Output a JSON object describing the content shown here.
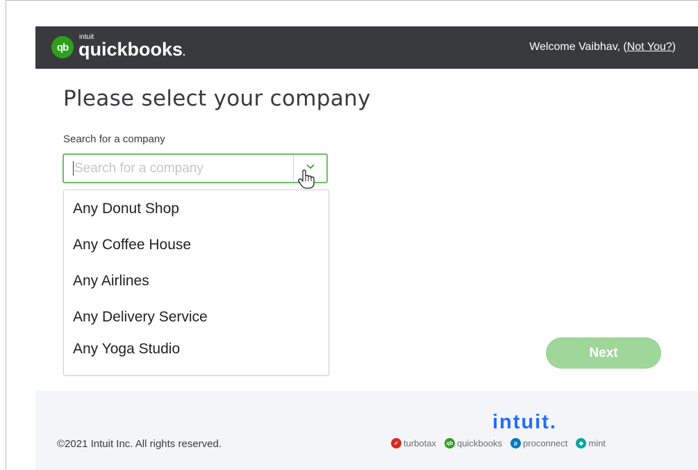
{
  "header": {
    "logo_badge": "qb",
    "brand_small": "intuit",
    "brand_name": "quickbooks",
    "brand_dot": ".",
    "welcome_text": "Welcome Vaibhav, (",
    "not_you_link": "Not You?",
    "welcome_close": ")"
  },
  "main": {
    "title": "Please select your company",
    "search_label": "Search for a company",
    "search_placeholder": "Search for a company",
    "search_value": "",
    "companies": [
      "Any Donut Shop",
      "Any Coffee House",
      "Any Airlines",
      "Any Delivery Service",
      "Any Yoga Studio"
    ],
    "next_label": "Next"
  },
  "footer": {
    "copyright": "©2021 Intuit Inc. All rights reserved.",
    "intuit_logo": "intuit.",
    "brands": [
      "turbotax",
      "quickbooks",
      "proconnect",
      "mint"
    ]
  },
  "colors": {
    "header_bg": "#393a3d",
    "brand_green": "#2ca01c",
    "focus_border": "#6bbf65",
    "next_disabled": "#9fd69a",
    "intuit_blue": "#236cff",
    "turbotax_red": "#d52b1e",
    "proconnect_blue": "#0077c5",
    "mint_teal": "#00a6a4"
  }
}
